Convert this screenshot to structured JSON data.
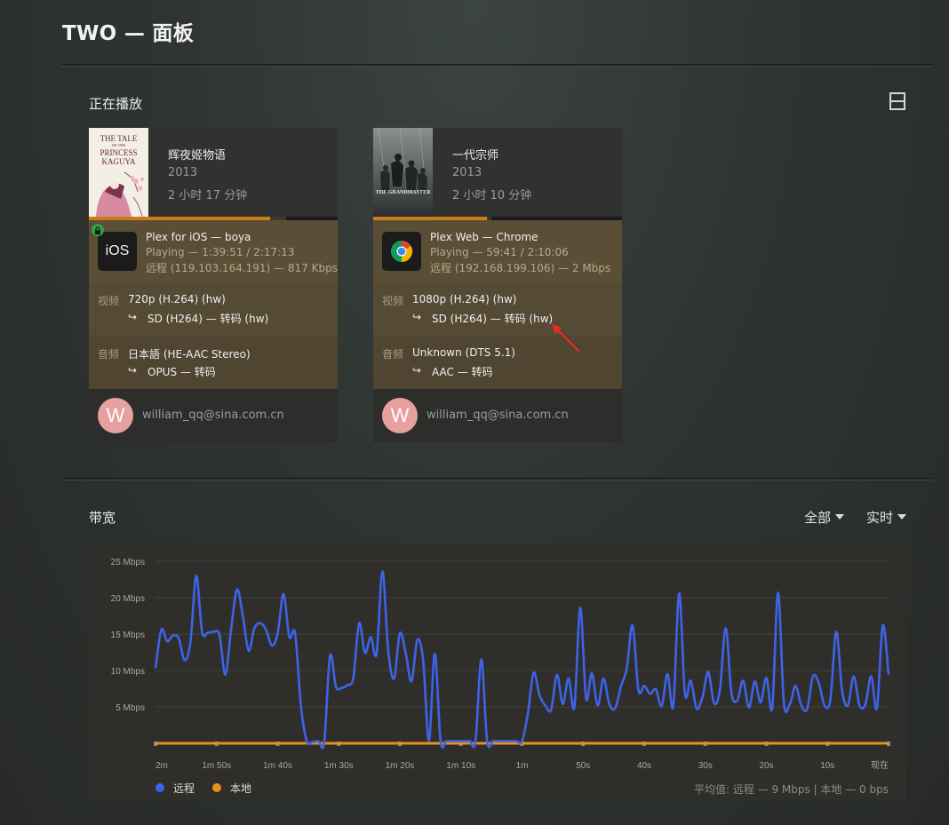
{
  "header": {
    "title": "TWO — 面板"
  },
  "now_playing": {
    "section_title": "正在播放",
    "menu_icon": "list-icon",
    "sessions": [
      {
        "movie_title": "辉夜姬物语",
        "year": "2013",
        "duration": "2 小时 17 分钟",
        "poster_text": [
          "THE TALE",
          "OF THE",
          "PRINCESS",
          "KAGUYA"
        ],
        "progress_played": 0.727,
        "progress_buffered": 0.794,
        "locked": true,
        "player_icon": "ios-app-icon",
        "player_icon_text": "iOS",
        "player_name": "Plex for iOS  —  boya",
        "playback_state": "Playing — 1:39:51 / 2:17:13",
        "network": "远程 (119.103.164.191) — 817 Kbps",
        "video_label": "视频",
        "video_source": "720p (H.264) (hw)",
        "video_target": "SD (H264) — 转码 (hw)",
        "audio_label": "音频",
        "audio_source": "日本語 (HE-AAC Stereo)",
        "audio_target": "OPUS — 转码",
        "arrow_glyph": "↪",
        "avatar_letter": "W",
        "user": "william_qq@sina.com.cn"
      },
      {
        "movie_title": "一代宗师",
        "year": "2013",
        "duration": "2 小时 10 分钟",
        "poster_text": [
          "THE GRANDMASTER"
        ],
        "progress_played": 0.457,
        "progress_buffered": 0.475,
        "locked": false,
        "player_icon": "chrome-icon",
        "player_icon_text": "",
        "player_name": "Plex Web  —  Chrome",
        "playback_state": "Playing — 59:41 / 2:10:06",
        "network": "远程 (192.168.199.106) — 2 Mbps",
        "video_label": "视频",
        "video_source": "1080p (H.264) (hw)",
        "video_target": "SD (H264) — 转码 (hw)",
        "audio_label": "音频",
        "audio_source": "Unknown (DTS 5.1)",
        "audio_target": "AAC — 转码",
        "arrow_glyph": "↪",
        "avatar_letter": "W",
        "user": "william_qq@sina.com.cn"
      }
    ],
    "annotation": "red-arrow"
  },
  "bandwidth": {
    "section_title": "带宽",
    "filter_dropdown": "全部",
    "range_dropdown": "实时",
    "legend": [
      {
        "label": "远程",
        "color": "#3d63e8"
      },
      {
        "label": "本地",
        "color": "#e2921e"
      }
    ],
    "average": "平均值: 远程 — 9 Mbps | 本地 — 0 bps"
  },
  "chart_data": {
    "type": "line",
    "title": "",
    "xlabel": "",
    "ylabel": "",
    "ylim": [
      0,
      25
    ],
    "y_ticks": [
      "25 Mbps",
      "20 Mbps",
      "15 Mbps",
      "10 Mbps",
      "5 Mbps"
    ],
    "y_tick_values": [
      25,
      20,
      15,
      10,
      5
    ],
    "x_ticks": [
      "2m",
      "1m 50s",
      "1m 40s",
      "1m 30s",
      "1m 20s",
      "1m 10s",
      "1m",
      "50s",
      "40s",
      "30s",
      "20s",
      "10s",
      "现在"
    ],
    "x_range_seconds": [
      -120,
      0
    ],
    "grid": true,
    "legend_position": "bottom-left",
    "series": [
      {
        "name": "远程",
        "color": "#3d63e8",
        "values": [
          10.3,
          15.6,
          14,
          14.8,
          14.4,
          11.4,
          13.9,
          23,
          15.3,
          15.2,
          15.3,
          14.9,
          9.4,
          15.7,
          21.1,
          17.6,
          12.7,
          15.8,
          16.5,
          15.6,
          13.4,
          15.1,
          20.5,
          14.6,
          15.1,
          5.1,
          0.3,
          0.2,
          0.3,
          0.2,
          12,
          7.8,
          7.6,
          8,
          9,
          16.5,
          12.4,
          14.6,
          12.3,
          23.6,
          12.7,
          8.9,
          15.1,
          12.4,
          8.5,
          14.2,
          11.4,
          0.3,
          12.3,
          0.3,
          0.3,
          0.3,
          0.3,
          0.3,
          0.3,
          0.3,
          11.5,
          0.3,
          0.3,
          0.3,
          0.3,
          0.3,
          0.3,
          0.3,
          4.1,
          9.7,
          6.6,
          5.2,
          4.6,
          9.4,
          5.4,
          8.9,
          5,
          18.6,
          6.2,
          9.6,
          5.2,
          8.9,
          5.4,
          4.8,
          7.8,
          10.3,
          16.2,
          7.3,
          7.9,
          6.8,
          7.4,
          5.1,
          9.5,
          5.1,
          20.6,
          6.8,
          8.6,
          4.8,
          6.3,
          9.8,
          5.5,
          7.3,
          15.8,
          6.9,
          5.9,
          8.6,
          4.9,
          8.5,
          5.6,
          9,
          4.9,
          20.7,
          5.6,
          5.3,
          7.9,
          5.2,
          4.7,
          9.2,
          8.3,
          5.2,
          6,
          15.3,
          7.3,
          5.2,
          9.2,
          5.2,
          5.3,
          9.2,
          4.8,
          16.2,
          9.4
        ],
        "x_start": -120,
        "x_step": 0.9524
      },
      {
        "name": "本地",
        "color": "#e2921e",
        "values": [
          0,
          0
        ],
        "x": [
          -120,
          0
        ]
      }
    ]
  }
}
